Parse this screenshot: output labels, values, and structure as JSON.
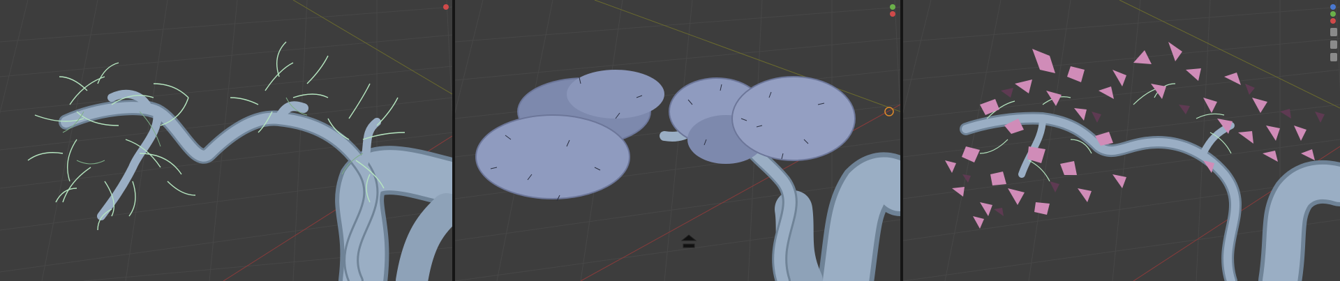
{
  "window": {
    "viewports": [
      {
        "name": "viewport-branches",
        "kind": "branch-mesh-with-twigs"
      },
      {
        "name": "viewport-canopy-blobs",
        "kind": "canopy-volume-blobs"
      },
      {
        "name": "viewport-leaves",
        "kind": "branch-mesh-with-leaves"
      }
    ]
  },
  "colors": {
    "viewport_bg": "#3d3d3d",
    "grid_line": "#474747",
    "separator": "#151515",
    "branch_mesh": "#9aaec4",
    "branch_shadow": "#6f8397",
    "twig": "#b6e6c0",
    "blob": "#8f9bbf",
    "blob_shadow": "#6c7699",
    "leaf": "#d08cb8",
    "leaf_dark": "#5e3a52",
    "axis_x": "#8a3b3b",
    "axis_y": "#6b6b2e",
    "gizmo_red": "#d04a4a",
    "gizmo_green": "#6bb04a",
    "gizmo_blue": "#4a78d0",
    "cursor_orange": "#e08a2a"
  },
  "icons": [
    "navigation-gizmo-icon",
    "3d-cursor-icon",
    "camera-icon",
    "hand-icon"
  ]
}
